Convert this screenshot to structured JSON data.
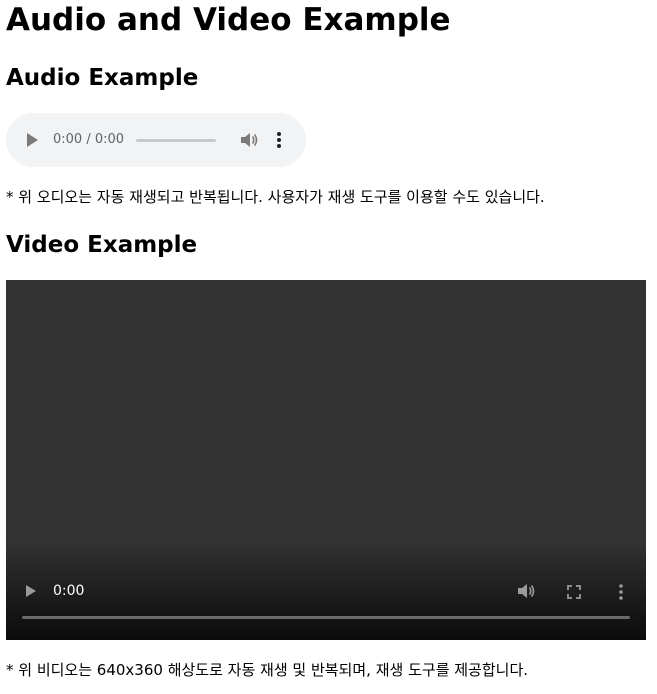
{
  "title": "Audio and Video Example",
  "audio": {
    "heading": "Audio Example",
    "player": {
      "time": "0:00 / 0:00",
      "play_icon": "play-icon",
      "volume_icon": "volume-icon",
      "menu_icon": "more-vert-icon",
      "progress": 0
    },
    "note": "* 위 오디오는 자동 재생되고 반복됩니다. 사용자가 재생 도구를 이용할 수도 있습니다."
  },
  "video": {
    "heading": "Video Example",
    "player": {
      "time": "0:00",
      "play_icon": "play-icon",
      "volume_icon": "volume-icon",
      "fullscreen_icon": "fullscreen-icon",
      "menu_icon": "more-vert-icon",
      "progress": 0
    },
    "note": "* 위 비디오는 640x360 해상도로 자동 재생 및 반복되며, 재생 도구를 제공합니다."
  }
}
